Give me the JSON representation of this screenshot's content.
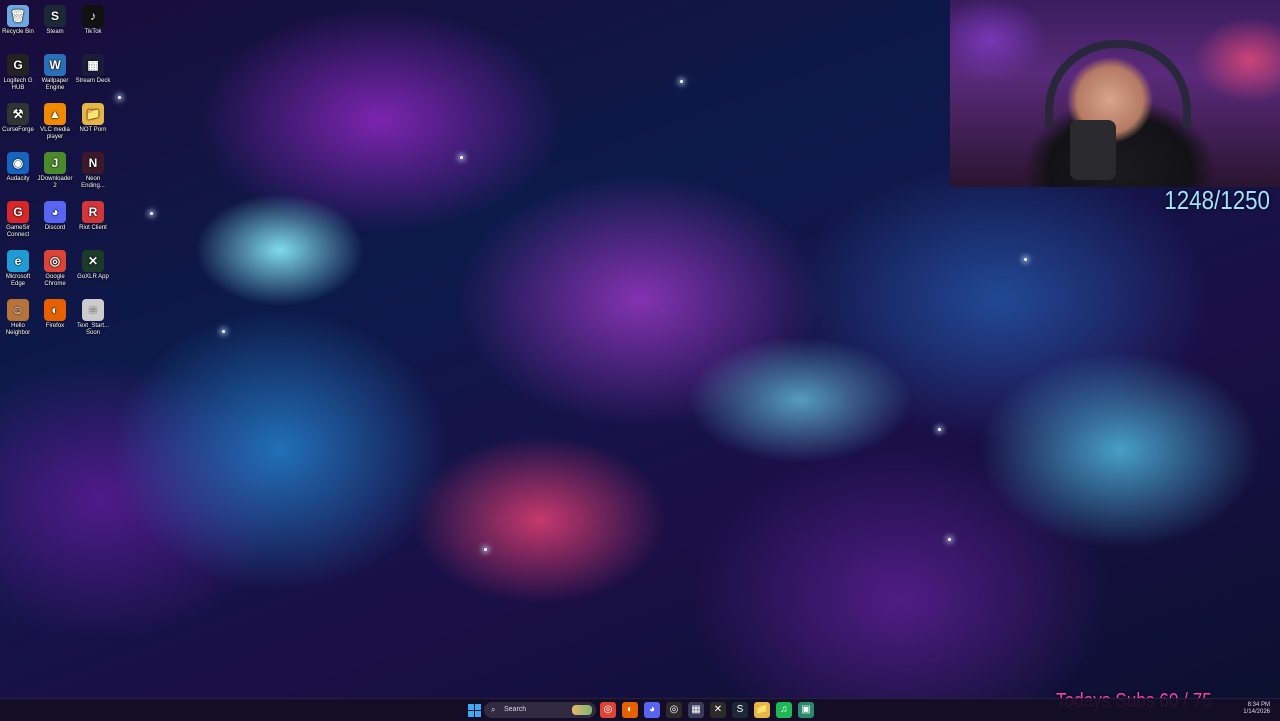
{
  "desktop": {
    "icons": [
      {
        "label": "Recycle Bin",
        "icon": "recycle-bin-icon",
        "color": "#6fa8dc",
        "glyph": "🗑"
      },
      {
        "label": "Steam",
        "icon": "steam-icon",
        "color": "#1b2838",
        "glyph": "S"
      },
      {
        "label": "TikTok",
        "icon": "tiktok-icon",
        "color": "#111111",
        "glyph": "♪"
      },
      {
        "label": "Logitech G HUB",
        "icon": "logitech-icon",
        "color": "#222222",
        "glyph": "G"
      },
      {
        "label": "Wallpaper Engine",
        "icon": "wallpaper-engine-icon",
        "color": "#2a6fb8",
        "glyph": "W"
      },
      {
        "label": "Stream Deck",
        "icon": "stream-deck-icon",
        "color": "#1c1c3a",
        "glyph": "▦"
      },
      {
        "label": "CurseForge",
        "icon": "curseforge-icon",
        "color": "#333333",
        "glyph": "⚒"
      },
      {
        "label": "VLC media player",
        "icon": "vlc-icon",
        "color": "#f08a00",
        "glyph": "▲"
      },
      {
        "label": "NOT Porn",
        "icon": "folder-icon",
        "color": "#e8b548",
        "glyph": "📁"
      },
      {
        "label": "Audacity",
        "icon": "audacity-icon",
        "color": "#1565c0",
        "glyph": "◉"
      },
      {
        "label": "JDownloader 2",
        "icon": "jdownloader-icon",
        "color": "#4a8a2a",
        "glyph": "J"
      },
      {
        "label": "Neon Ending...",
        "icon": "neon-ending-icon",
        "color": "#3a1a2a",
        "glyph": "N"
      },
      {
        "label": "GameSir Connect",
        "icon": "gamesir-icon",
        "color": "#d62828",
        "glyph": "G"
      },
      {
        "label": "Discord",
        "icon": "discord-icon",
        "color": "#5865f2",
        "glyph": "◕"
      },
      {
        "label": "Riot Client",
        "icon": "riot-client-icon",
        "color": "#d13639",
        "glyph": "R"
      },
      {
        "label": "Microsoft Edge",
        "icon": "edge-icon",
        "color": "#1f9bd6",
        "glyph": "e"
      },
      {
        "label": "Google Chrome",
        "icon": "chrome-icon",
        "color": "#db4437",
        "glyph": "◎"
      },
      {
        "label": "GoXLR App",
        "icon": "goxlr-icon",
        "color": "#1a3a2a",
        "glyph": "✕"
      },
      {
        "label": "Hello Neighbor",
        "icon": "hello-neighbor-icon",
        "color": "#b8733a",
        "glyph": "☺"
      },
      {
        "label": "Firefox",
        "icon": "firefox-icon",
        "color": "#e66000",
        "glyph": "◐"
      },
      {
        "label": "Text_Start... Soon",
        "icon": "text-file-icon",
        "color": "#cccccc",
        "glyph": "≡"
      }
    ]
  },
  "overlay": {
    "sub_counter": "1248/1250",
    "todays_subs": "Todays Subs  60 / 75"
  },
  "taskbar": {
    "search_placeholder": "Search",
    "pinned": [
      {
        "icon": "chrome-icon",
        "color": "#db4437",
        "glyph": "◎"
      },
      {
        "icon": "firefox-icon",
        "color": "#e66000",
        "glyph": "◐"
      },
      {
        "icon": "discord-icon",
        "color": "#5865f2",
        "glyph": "◕"
      },
      {
        "icon": "chrome-icon",
        "color": "#2a2a2a",
        "glyph": "◎"
      },
      {
        "icon": "stream-deck-icon",
        "color": "#3a3a5a",
        "glyph": "▦"
      },
      {
        "icon": "goxlr-icon",
        "color": "#2a2a2a",
        "glyph": "✕"
      },
      {
        "icon": "steam-icon",
        "color": "#1b2838",
        "glyph": "S"
      },
      {
        "icon": "file-explorer-icon",
        "color": "#e8b548",
        "glyph": "📁"
      },
      {
        "icon": "spotify-icon",
        "color": "#1db954",
        "glyph": "♫"
      },
      {
        "icon": "app-icon",
        "color": "#2a8a6a",
        "glyph": "▣"
      }
    ],
    "time": "8:34 PM",
    "date": "1/14/2026"
  }
}
